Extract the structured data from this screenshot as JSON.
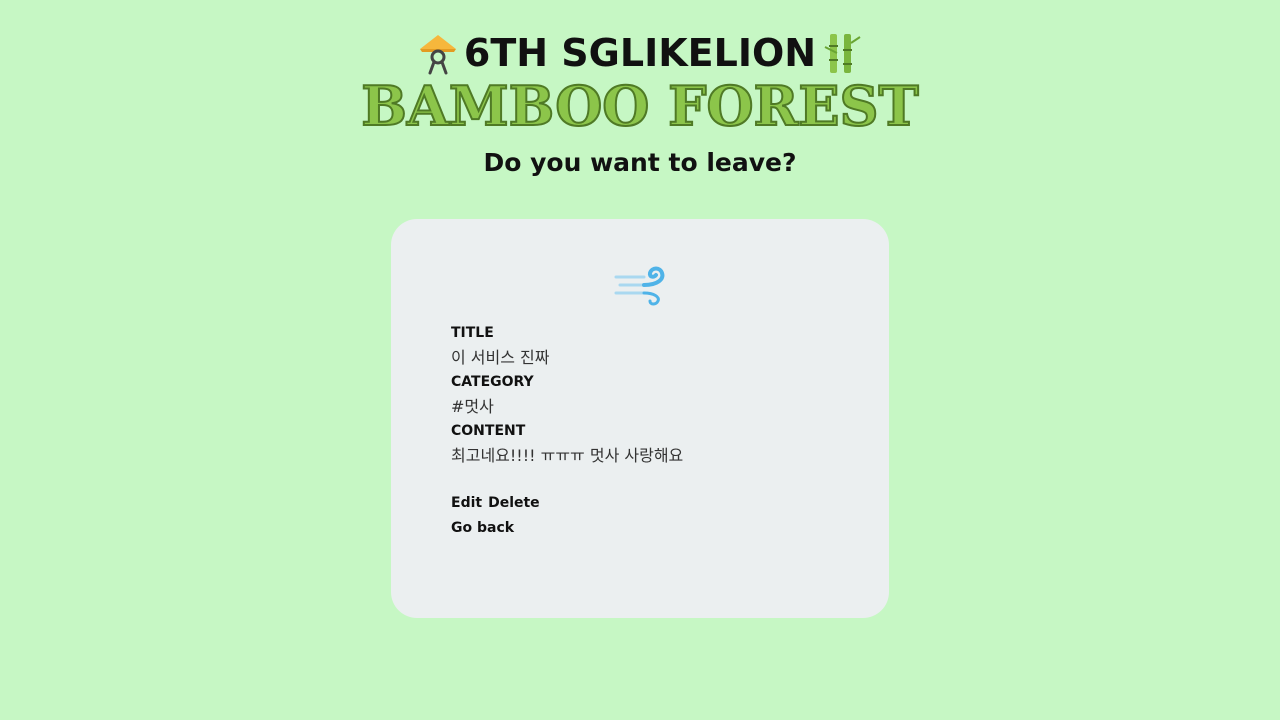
{
  "header": {
    "title": "6TH SGLIKELION",
    "subtitle": "BAMBOO FOREST",
    "question": "Do you want to leave?",
    "left_icon": "rice-hat-person-icon",
    "right_icon": "bamboo-icon"
  },
  "post": {
    "icon": "wind-icon",
    "title_label": "TITLE",
    "title_value": "이 서비스 진짜",
    "category_label": "CATEGORY",
    "category_value": "#멋사",
    "content_label": "CONTENT",
    "content_value": "최고네요!!!! ㅠㅠㅠ 멋사 사랑해요"
  },
  "actions": {
    "edit_label": "Edit",
    "delete_label": "Delete",
    "back_label": "Go back"
  },
  "colors": {
    "background": "#c6f7c4",
    "card": "#ebeff0",
    "accent_green": "#8cc54a",
    "wind_blue": "#4fb3e8"
  }
}
